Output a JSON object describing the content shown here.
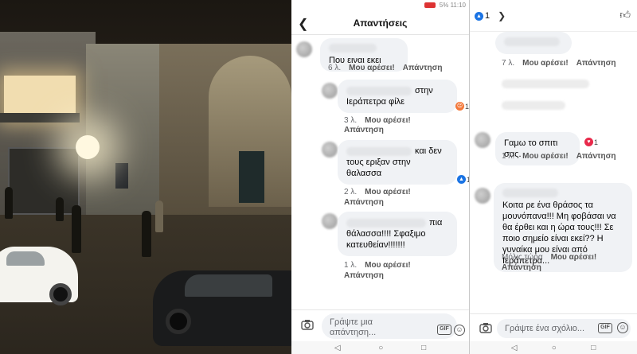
{
  "panel_replies": {
    "title": "Απαντήσεις",
    "comments": [
      {
        "text": "Που ειναι εκει",
        "time": "6 λ.",
        "like": "Μου αρέσει!",
        "reply": "Απάντηση"
      },
      {
        "text_line1": "στην",
        "text_line2": "Ιεράπετρα φίλε",
        "time": "3 λ.",
        "like": "Μου αρέσει!",
        "reply": "Απάντηση",
        "reaction_count": "1"
      },
      {
        "text_line1": "και δεν",
        "text_line2": "τους εριξαν στην",
        "text_line3": "θαλασσα",
        "time": "2 λ.",
        "like": "Μου αρέσει!",
        "reply": "Απάντηση",
        "reaction_count": "1"
      },
      {
        "text_line1": "πια",
        "text_line2": "θάλασσα!!!! Σφαξιμο",
        "text_line3": "κατευθείαν!!!!!!!",
        "time": "1 λ.",
        "like": "Μου αρέσει!",
        "reply": "Απάντηση"
      }
    ],
    "composer_placeholder_line1": "Γράψτε μια",
    "composer_placeholder_line2": "απάντηση...",
    "gif_label": "GIF"
  },
  "panel_post": {
    "reaction_total": "1",
    "comments": [
      {
        "time": "7 λ.",
        "like": "Μου αρέσει!",
        "reply": "Απάντηση"
      },
      {
        "text": "Γαμω το σπιτι σας.",
        "time": "1 λ.",
        "like": "Μου αρέσει!",
        "reply": "Απάντηση",
        "reaction_count": "1"
      },
      {
        "text": "Κοιτα ρε ένα θράσος τα μουνόπανα!!! Μη φοβάσαι να θα έρθει και η ώρα τους!!! Σε ποιο σημείο είναι εκεί?? Η γυναίκα μου είναι από Ιεράπετρα...",
        "time": "Μόλις τώρα",
        "like": "Μου αρέσει!",
        "reply": "Απάντηση"
      }
    ],
    "composer_placeholder": "Γράψτε ένα σχόλιο...",
    "gif_label": "GIF"
  },
  "status": {
    "battery": "5%",
    "time": "11:10"
  },
  "icons": {
    "back": "arrow-left-icon",
    "camera": "camera-icon",
    "gif": "gif-icon",
    "emoji": "smile-icon",
    "like": "thumbs-up-icon",
    "angry": "angry-reaction-icon",
    "love": "love-reaction-icon"
  },
  "colors": {
    "bubble": "#f0f2f5",
    "meta": "#65676b",
    "like_blue": "#1b74e4",
    "love_red": "#e8294a",
    "angry_orange": "#f3783a"
  }
}
